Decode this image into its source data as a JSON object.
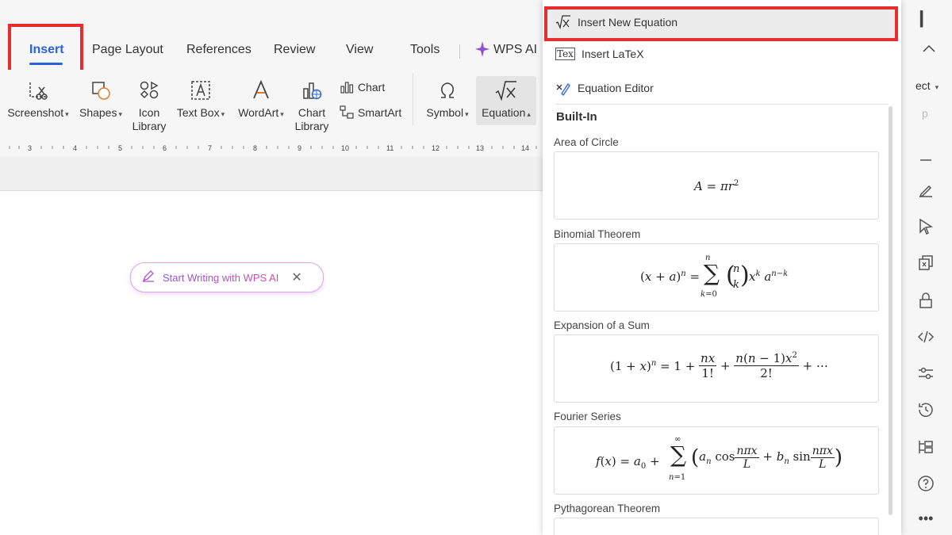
{
  "tabs": [
    "Insert",
    "Page Layout",
    "References",
    "Review",
    "View",
    "Tools",
    "WPS AI"
  ],
  "ribbon": {
    "screenshot": "Screenshot",
    "shapes": "Shapes",
    "icon_library_1": "Icon",
    "icon_library_2": "Library",
    "text_box": "Text Box",
    "wordart": "WordArt",
    "chart_library_1": "Chart",
    "chart_library_2": "Library",
    "chart": "Chart",
    "smartart": "SmartArt",
    "symbol": "Symbol",
    "equation": "Equation"
  },
  "ruler_ticks": [
    "3",
    "4",
    "5",
    "6",
    "7",
    "8",
    "9",
    "10",
    "11",
    "12",
    "13",
    "14"
  ],
  "ai_pill": "Start Writing with WPS AI",
  "dropdown": {
    "insert_new_equation": "Insert New Equation",
    "insert_latex": "Insert LaTeX",
    "equation_editor": "Equation Editor",
    "builtin": "Built-In",
    "sections": [
      "Area of Circle",
      "Binomial Theorem",
      "Expansion of a Sum",
      "Fourier Series",
      "Pythagorean Theorem"
    ]
  },
  "partial_right": {
    "select": "ect",
    "p": "p"
  },
  "colors": {
    "accent": "#2b62d6",
    "highlight": "#e62e2e"
  },
  "icons": [
    "screenshot-icon",
    "shapes-icon",
    "icon-library-icon",
    "text-box-icon",
    "wordart-icon",
    "chart-library-icon",
    "chart-icon",
    "smartart-icon",
    "symbol-icon",
    "equation-icon",
    "pen-icon",
    "close-icon",
    "minimize-icon",
    "edit-icon",
    "select-icon",
    "copy-icon",
    "lock-icon",
    "code-icon",
    "settings-icon",
    "history-icon",
    "outline-icon",
    "help-icon",
    "more-icon"
  ]
}
